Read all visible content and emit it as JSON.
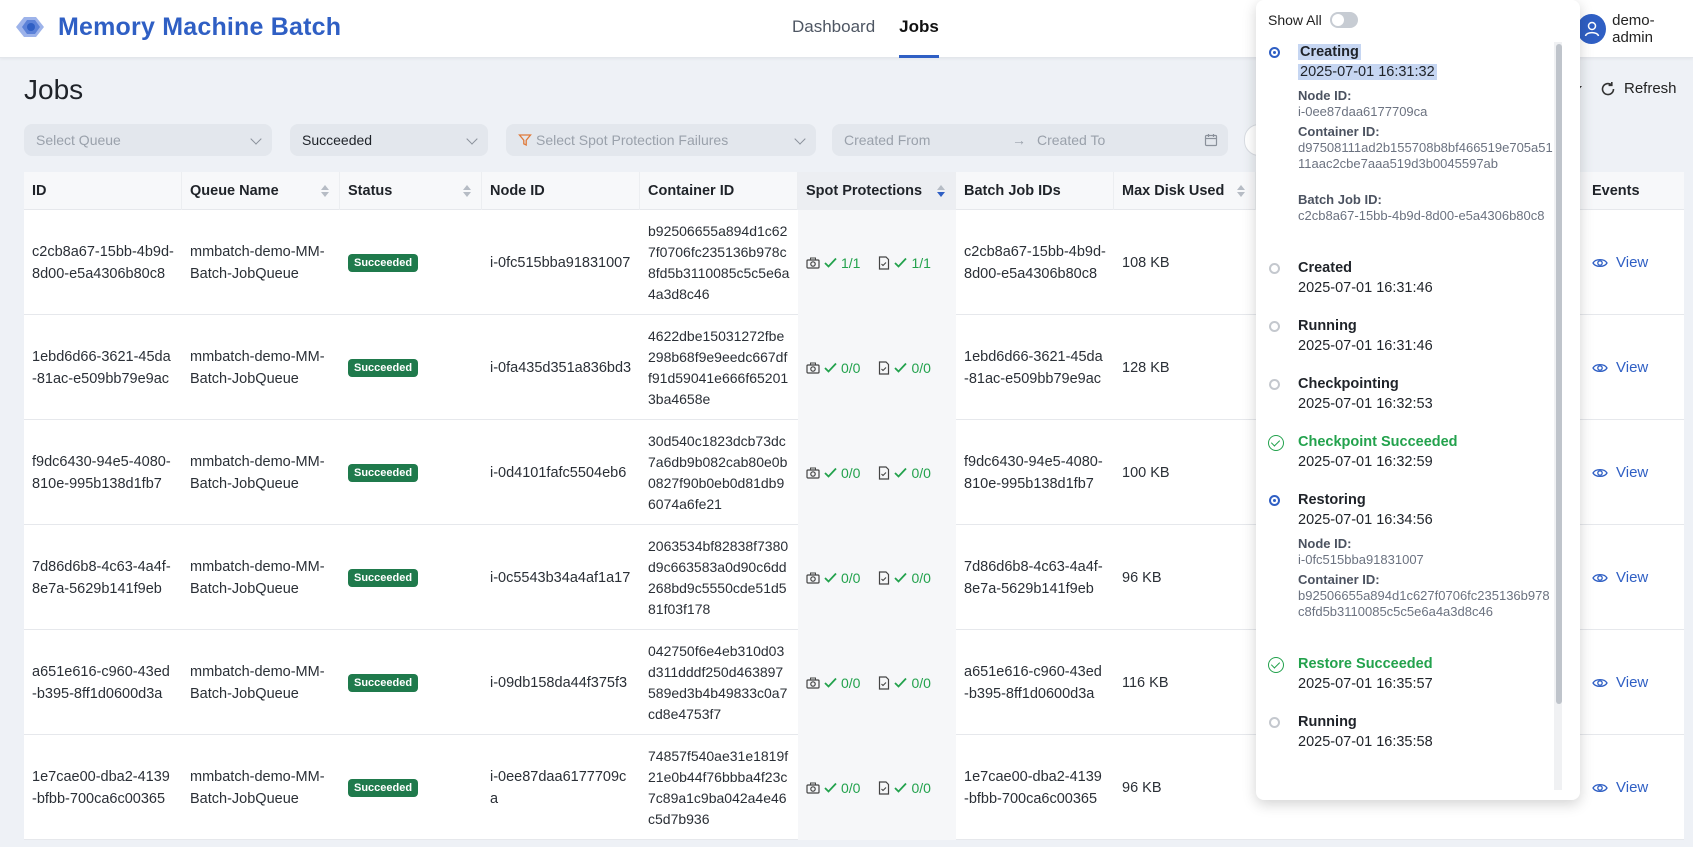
{
  "app": {
    "title": "Memory Machine Batch",
    "user": "demo-admin"
  },
  "nav": [
    {
      "label": "Dashboard",
      "active": false
    },
    {
      "label": "Jobs",
      "active": true
    }
  ],
  "page": {
    "title": "Jobs",
    "refresh_label": "Refresh"
  },
  "filters": {
    "queue_placeholder": "Select Queue",
    "status_value": "Succeeded",
    "spot_placeholder": "Select Spot Protection Failures",
    "created_from_placeholder": "Created From",
    "created_to_placeholder": "Created To",
    "arrow": "→"
  },
  "table": {
    "columns": [
      "ID",
      "Queue Name",
      "Status",
      "Node ID",
      "Container ID",
      "Spot Protections",
      "Batch Job IDs",
      "Max Disk Used",
      "Events"
    ],
    "view_label": "View",
    "rows": [
      {
        "id": "c2cb8a67-15bb-4b9d-8d00-e5a4306b80c8",
        "queue": "mmbatch-demo-MM-Batch-JobQueue",
        "status": "Succeeded",
        "node": "i-0fc515bba91831007",
        "container": "b92506655a894d1c627f0706fc235136b978c8fd5b3110085c5c5e6a4a3d8c46",
        "spot_a": "1/1",
        "spot_b": "1/1",
        "batch": "c2cb8a67-15bb-4b9d-8d00-e5a4306b80c8",
        "disk": "108 KB"
      },
      {
        "id": "1ebd6d66-3621-45da-81ac-e509bb79e9ac",
        "queue": "mmbatch-demo-MM-Batch-JobQueue",
        "status": "Succeeded",
        "node": "i-0fa435d351a836bd3",
        "container": "4622dbe15031272fbe298b68f9e9eedc667dff91d59041e666f652013ba4658e",
        "spot_a": "0/0",
        "spot_b": "0/0",
        "batch": "1ebd6d66-3621-45da-81ac-e509bb79e9ac",
        "disk": "128 KB"
      },
      {
        "id": "f9dc6430-94e5-4080-810e-995b138d1fb7",
        "queue": "mmbatch-demo-MM-Batch-JobQueue",
        "status": "Succeeded",
        "node": "i-0d4101fafc5504eb6",
        "container": "30d540c1823dcb73dc7a6db9b082cab80e0b0827f90b0eb0d81db96074a6fe21",
        "spot_a": "0/0",
        "spot_b": "0/0",
        "batch": "f9dc6430-94e5-4080-810e-995b138d1fb7",
        "disk": "100 KB"
      },
      {
        "id": "7d86d6b8-4c63-4a4f-8e7a-5629b141f9eb",
        "queue": "mmbatch-demo-MM-Batch-JobQueue",
        "status": "Succeeded",
        "node": "i-0c5543b34a4af1a17",
        "container": "2063534bf82838f7380d9c663583a0d90c6dd268bd9c5550cde51d581f03f178",
        "spot_a": "0/0",
        "spot_b": "0/0",
        "batch": "7d86d6b8-4c63-4a4f-8e7a-5629b141f9eb",
        "disk": "96 KB"
      },
      {
        "id": "a651e616-c960-43ed-b395-8ff1d0600d3a",
        "queue": "mmbatch-demo-MM-Batch-JobQueue",
        "status": "Succeeded",
        "node": "i-09db158da44f375f3",
        "container": "042750f6e4eb310d03d311dddf250d463897589ed3b4b49833c0a7cd8e4753f7",
        "spot_a": "0/0",
        "spot_b": "0/0",
        "batch": "a651e616-c960-43ed-b395-8ff1d0600d3a",
        "disk": "116 KB"
      },
      {
        "id": "1e7cae00-dba2-4139-bfbb-700ca6c00365",
        "queue": "mmbatch-demo-MM-Batch-JobQueue",
        "status": "Succeeded",
        "node": "i-0ee87daa6177709ca",
        "container": "74857f540ae31e1819f21e0b44f76bbba4f23c7c89a1c9ba042a4e46c5d7b936",
        "spot_a": "0/0",
        "spot_b": "0/0",
        "batch": "1e7cae00-dba2-4139-bfbb-700ca6c00365",
        "disk": "96 KB"
      }
    ]
  },
  "events_popover": {
    "show_all_label": "Show All",
    "show_all_on": false,
    "events": [
      {
        "title": "Creating",
        "time": "2025-07-01 16:31:32",
        "status": "active",
        "details": [
          {
            "label": "Node ID:",
            "value": "i-0ee87daa6177709ca"
          },
          {
            "label": "Container ID:",
            "value": "d97508111ad2b155708b8bf466519e705a5111aac2cbe7aaa519d3b0045597ab"
          },
          {
            "label": "Batch Job ID:",
            "value": "c2cb8a67-15bb-4b9d-8d00-e5a4306b80c8"
          }
        ]
      },
      {
        "title": "Created",
        "time": "2025-07-01 16:31:46",
        "status": "done"
      },
      {
        "title": "Running",
        "time": "2025-07-01 16:31:46",
        "status": "done"
      },
      {
        "title": "Checkpointing",
        "time": "2025-07-01 16:32:53",
        "status": "done"
      },
      {
        "title": "Checkpoint Succeeded",
        "time": "2025-07-01 16:32:59",
        "status": "success"
      },
      {
        "title": "Restoring",
        "time": "2025-07-01 16:34:56",
        "status": "active",
        "details": [
          {
            "label": "Node ID:",
            "value": "i-0fc515bba91831007"
          },
          {
            "label": "Container ID:",
            "value": "b92506655a894d1c627f0706fc235136b978c8fd5b3110085c5c5e6a4a3d8c46"
          }
        ]
      },
      {
        "title": "Restore Succeeded",
        "time": "2025-07-01 16:35:57",
        "status": "success"
      },
      {
        "title": "Running",
        "time": "2025-07-01 16:35:58",
        "status": "done"
      }
    ]
  },
  "colors": {
    "brand": "#2f5fc4",
    "success": "#23a24d",
    "badge": "#1f7a4c"
  }
}
